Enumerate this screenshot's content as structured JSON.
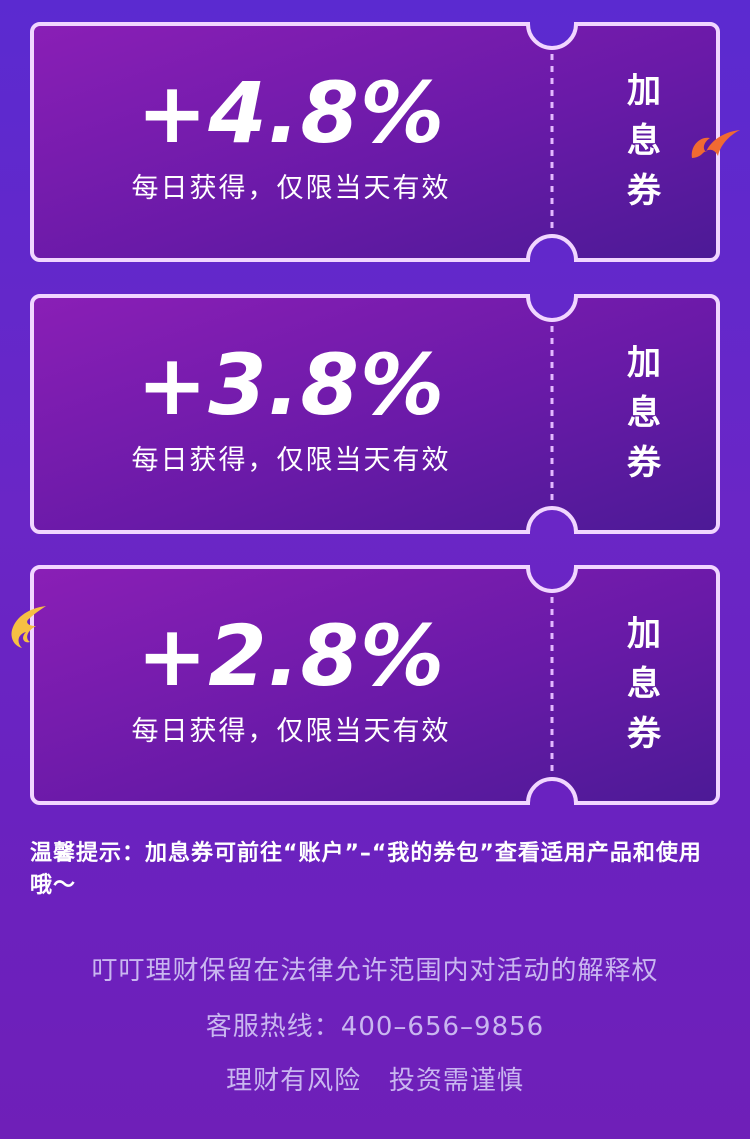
{
  "coupons": [
    {
      "rate": "+4.8%",
      "description": "每日获得，仅限当天有效",
      "label": [
        "加",
        "息",
        "券"
      ]
    },
    {
      "rate": "+3.8%",
      "description": "每日获得，仅限当天有效",
      "label": [
        "加",
        "息",
        "券"
      ]
    },
    {
      "rate": "+2.8%",
      "description": "每日获得，仅限当天有效",
      "label": [
        "加",
        "息",
        "券"
      ]
    }
  ],
  "tip": "温馨提示：加息券可前往“账户”–“我的券包”查看适用产品和使用哦～",
  "footer": {
    "rights": "叮叮理财保留在法律允许范围内对活动的解释权",
    "hotline": "客服热线：400–656–9856",
    "risk": "理财有风险   投资需谨慎"
  },
  "colors": {
    "background": "#5b2ad0",
    "coupon_border": "#f1d6ff",
    "coupon_fill_start": "#7f1fb0",
    "coupon_fill_end": "#4e1898",
    "text": "#ffffff",
    "footer_text": "#c9b6f0",
    "deco_orange": "#f06a32",
    "deco_gold": "#f6c043"
  },
  "icons": {
    "flame_right": "flame-swoosh-icon",
    "flame_left": "gold-swoosh-icon"
  }
}
